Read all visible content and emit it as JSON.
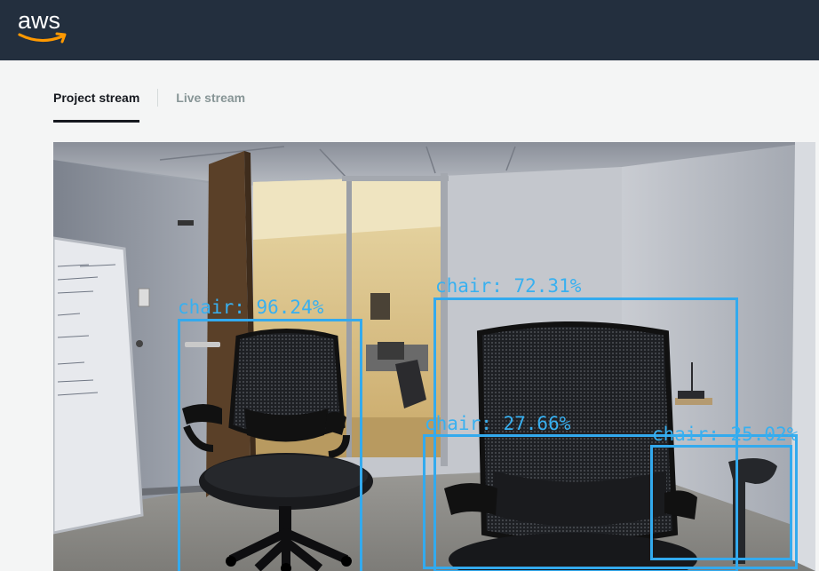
{
  "header": {
    "logo_text": "aws",
    "brand_color": "#232f3e",
    "smile_color": "#ff9900"
  },
  "tabs": [
    {
      "label": "Project stream",
      "active": true
    },
    {
      "label": "Live stream",
      "active": false
    }
  ],
  "stream": {
    "detection_color": "#33aaee",
    "detections": [
      {
        "label": "chair: 96.24%"
      },
      {
        "label": "chair: 72.31%"
      },
      {
        "label": "chair: 27.66%"
      },
      {
        "label": "chair: 25.02%"
      }
    ]
  }
}
